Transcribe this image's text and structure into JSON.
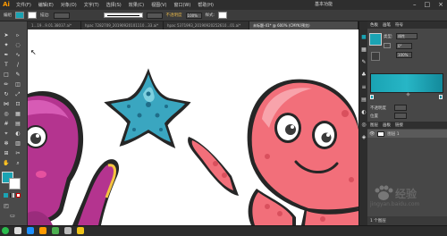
{
  "app": {
    "logo": "Ai"
  },
  "menu": {
    "items": [
      "文件(F)",
      "编辑(E)",
      "对象(O)",
      "文字(T)",
      "选择(S)",
      "效果(C)",
      "视图(V)",
      "窗口(W)",
      "帮助(H)"
    ],
    "workspace": "基本功能"
  },
  "control_bar": {
    "selection_label": "编组",
    "stroke_label": "描边:",
    "uniform_label": "不透明度",
    "opacity_value": "100%",
    "style_label": "样式:"
  },
  "tabs": [
    {
      "label": "1...19...9.01.38037.ai*",
      "active": false
    },
    {
      "label": "hpac 7282709_20190920101110...33.ai*",
      "active": false
    },
    {
      "label": "hpac 5371993_20190920252610...01.ai*",
      "active": false
    },
    {
      "label": "未标题-41* @ 600% (CMYK/预览)",
      "active": true
    }
  ],
  "panel": {
    "tabs": [
      "色板",
      "画笔",
      "符号"
    ],
    "type_label": "类型:",
    "type_value": "线性",
    "angle_value": "0°",
    "opacity_value": "100%",
    "stroke_label": "不透明度",
    "location_label": "位置",
    "layer_tabs": [
      "图层",
      "画板",
      "链接"
    ],
    "layer_name": "图层 1",
    "layer_count": "1 个图层"
  },
  "watermark": {
    "brand": "经验",
    "url": "jingyan.baidu.com"
  },
  "colors": {
    "teal_fill": "#1aa3b3",
    "octopus_pink": "#f26f7a",
    "octopus_purple": "#b4348f",
    "starfish": "#3aa6c0"
  }
}
